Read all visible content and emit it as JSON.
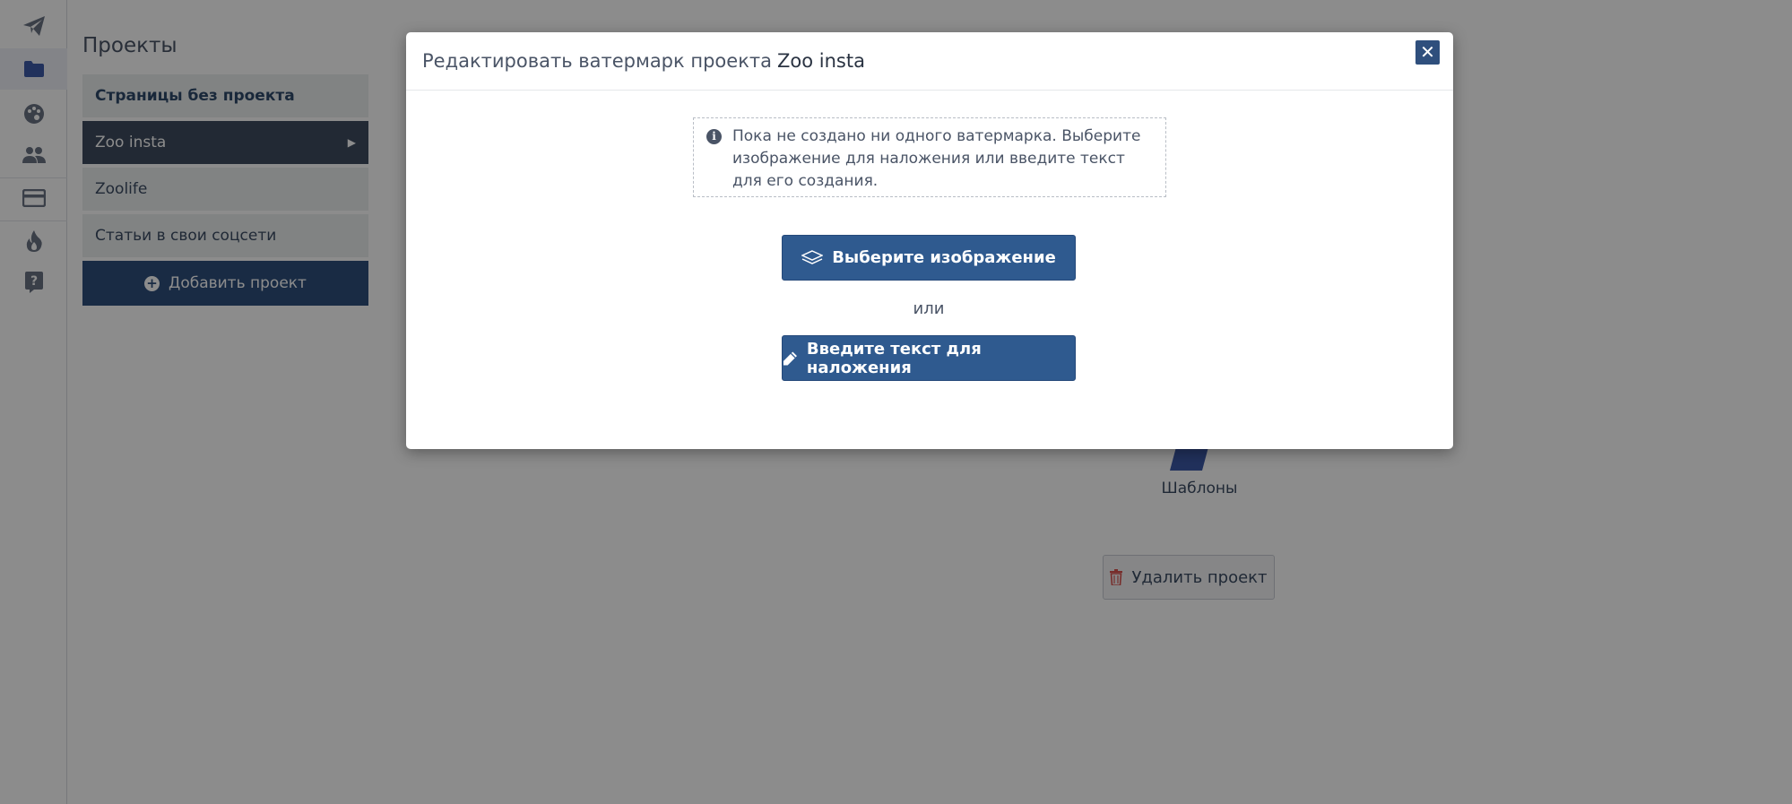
{
  "sidebar": {
    "icons": [
      "paper-plane-icon",
      "folder-icon",
      "palette-icon",
      "users-icon",
      "credit-card-icon",
      "fire-icon",
      "help-icon"
    ],
    "active_item": "folder-icon"
  },
  "page": {
    "title": "Проекты",
    "projects": [
      {
        "label": "Страницы без проекта"
      },
      {
        "label": "Zoo insta"
      },
      {
        "label": "Zoolife"
      },
      {
        "label": "Статьи в свои соцсети"
      }
    ],
    "add_project_label": "Добавить проект",
    "templates_label": "Шаблоны",
    "delete_project_label": "Удалить проект"
  },
  "modal": {
    "title_prefix": "Редактировать ватермарк проекта",
    "project_name": "Zoo insta",
    "close_symbol": "✕",
    "notice_text": "Пока не создано ни одного ватермарка. Выберите изображение для наложения или введите текст для его создания.",
    "choose_image_label": "Выберите изображение",
    "or_label": "или",
    "enter_text_label": "Введите текст для наложения"
  },
  "colors": {
    "primary": "#2f5a8f",
    "active_project": "#3e4b5f",
    "rail_active_icon": "#3d5aa8"
  }
}
